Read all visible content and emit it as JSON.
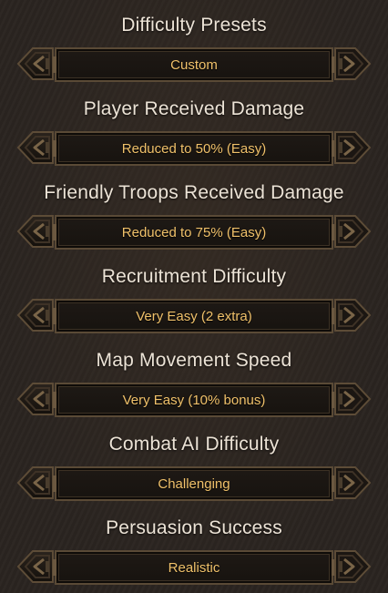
{
  "settings": [
    {
      "title": "Difficulty Presets",
      "value": "Custom"
    },
    {
      "title": "Player Received Damage",
      "value": "Reduced to 50% (Easy)"
    },
    {
      "title": "Friendly Troops Received Damage",
      "value": "Reduced to 75% (Easy)"
    },
    {
      "title": "Recruitment Difficulty",
      "value": "Very Easy (2 extra)"
    },
    {
      "title": "Map Movement Speed",
      "value": "Very Easy (10% bonus)"
    },
    {
      "title": "Combat AI Difficulty",
      "value": "Challenging"
    },
    {
      "title": "Persuasion Success",
      "value": "Realistic"
    }
  ],
  "icons": {
    "previous": "chevron-left-icon",
    "next": "chevron-right-icon"
  },
  "colors": {
    "background": "#2a2420",
    "title_text": "#ece3d6",
    "value_text": "#f0c16a",
    "frame": "#5a4a36"
  }
}
